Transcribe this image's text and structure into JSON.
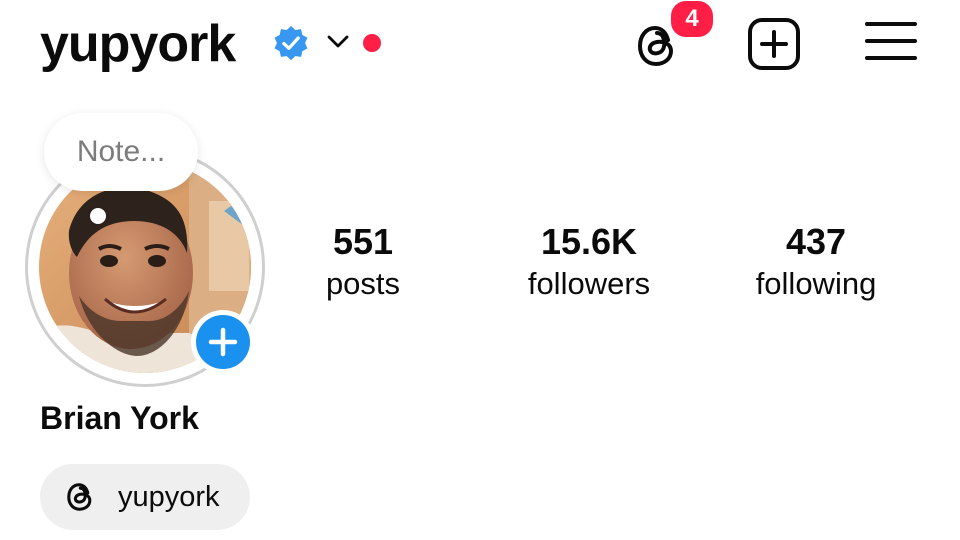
{
  "header": {
    "username": "yupyork",
    "verified_color": "#3897f0",
    "live_dot_color": "#ff1e45",
    "threads_icon": "threads-icon",
    "notification_count": "4",
    "create_icon": "plus-square-icon",
    "menu_icon": "hamburger-menu-icon"
  },
  "profile": {
    "note_placeholder": "Note...",
    "add_story_icon": "plus-icon",
    "full_name": "Brian York",
    "threads_link": "yupyork"
  },
  "stats": [
    {
      "value": "551",
      "label": "posts"
    },
    {
      "value": "15.6K",
      "label": "followers"
    },
    {
      "value": "437",
      "label": "following"
    }
  ]
}
